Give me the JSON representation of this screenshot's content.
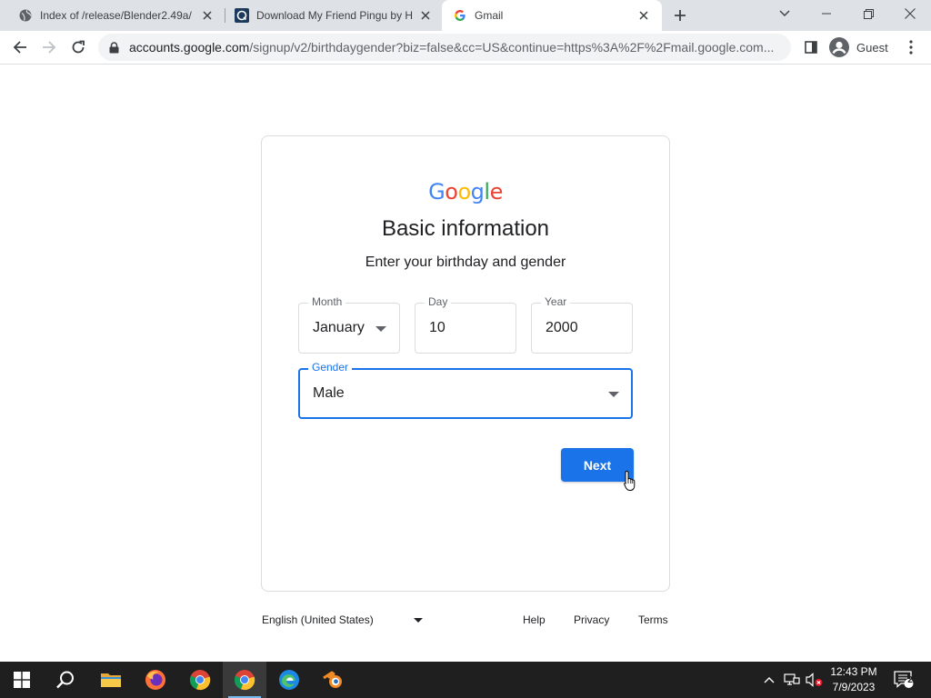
{
  "browser": {
    "tabs": [
      {
        "title": "Index of /release/Blender2.49a/",
        "favicon": "globe-icon",
        "active": false
      },
      {
        "title": "Download My Friend Pingu by H",
        "favicon": "download-site-icon",
        "active": false
      },
      {
        "title": "Gmail",
        "favicon": "google-g-icon",
        "active": true
      }
    ],
    "url_host": "accounts.google.com",
    "url_path": "/signup/v2/birthdaygender?biz=false&cc=US&continue=https%3A%2F%2Fmail.google.com...",
    "profile_label": "Guest"
  },
  "page": {
    "logo_text": "Google",
    "title": "Basic information",
    "subtitle": "Enter your birthday and gender",
    "fields": {
      "month": {
        "label": "Month",
        "value": "January"
      },
      "day": {
        "label": "Day",
        "value": "10"
      },
      "year": {
        "label": "Year",
        "value": "2000"
      },
      "gender": {
        "label": "Gender",
        "value": "Male"
      }
    },
    "next_label": "Next"
  },
  "footer": {
    "language": "English (United States)",
    "links": {
      "help": "Help",
      "privacy": "Privacy",
      "terms": "Terms"
    }
  },
  "taskbar": {
    "apps": [
      "windows-start-icon",
      "search-icon",
      "file-explorer-icon",
      "firefox-icon",
      "chrome-icon",
      "chrome-icon",
      "edge-icon",
      "blender-icon"
    ],
    "clock_time": "12:43 PM",
    "clock_date": "7/9/2023",
    "notification_count": "2"
  },
  "colors": {
    "accent": "#1a73e8",
    "google_blue": "#4285f4",
    "google_red": "#ea4335",
    "google_yellow": "#fbbc05",
    "google_green": "#34a853",
    "taskbar_bg": "#1f1f1f"
  }
}
